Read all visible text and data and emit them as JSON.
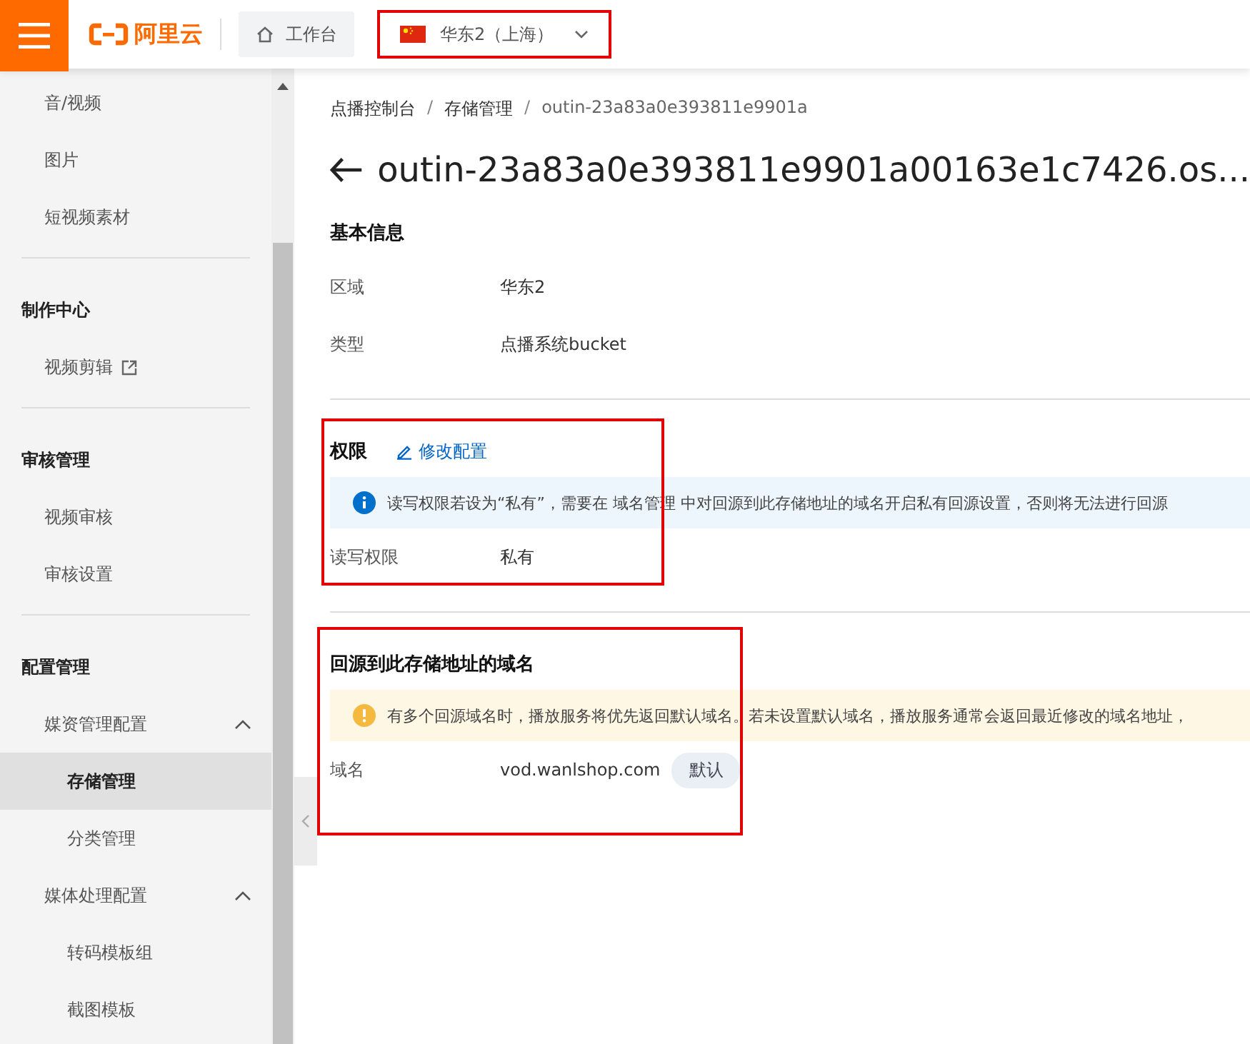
{
  "header": {
    "logo": "阿里云",
    "workbench": "工作台",
    "region": {
      "label": "华东2（上海）",
      "highlighted": true
    }
  },
  "sidebar": {
    "groups": [
      {
        "items": [
          {
            "label": "音/视频",
            "selected": false
          },
          {
            "label": "图片",
            "selected": false
          },
          {
            "label": "短视频素材",
            "selected": false
          }
        ]
      },
      {
        "title": "制作中心",
        "items": [
          {
            "label": "视频剪辑",
            "selected": false,
            "external": true
          }
        ]
      },
      {
        "title": "审核管理",
        "items": [
          {
            "label": "视频审核",
            "selected": false
          },
          {
            "label": "审核设置",
            "selected": false
          }
        ]
      },
      {
        "title": "配置管理",
        "items": [
          {
            "label": "媒资管理配置",
            "expanded": true,
            "children": [
              {
                "label": "存储管理",
                "selected": true
              },
              {
                "label": "分类管理",
                "selected": false
              }
            ]
          },
          {
            "label": "媒体处理配置",
            "expanded": true,
            "children": [
              {
                "label": "转码模板组",
                "selected": false
              },
              {
                "label": "截图模板",
                "selected": false
              }
            ]
          }
        ]
      }
    ]
  },
  "breadcrumb": [
    "点播控制台",
    "存储管理",
    "outin-23a83a0e393811e9901a"
  ],
  "breadcrumb_separator": "/",
  "title": "outin-23a83a0e393811e9901a00163e1c7426.os...",
  "sections": [
    {
      "title": "基本信息",
      "highlighted": false,
      "fields": [
        {
          "label": "区域",
          "value": "华东2"
        },
        {
          "label": "类型",
          "value": "点播系统bucket"
        }
      ]
    },
    {
      "title": "权限",
      "highlighted": true,
      "action": "修改配置",
      "notice": {
        "kind": "info",
        "text": "读写权限若设为“私有”，需要在 域名管理 中对回源到此存储地址的域名开启私有回源设置，否则将无法进行回源"
      },
      "fields": [
        {
          "label": "读写权限",
          "value": "私有"
        }
      ]
    },
    {
      "title": "回源到此存储地址的域名",
      "highlighted": true,
      "notice": {
        "kind": "warning",
        "text": "有多个回源域名时，播放服务将优先返回默认域名。若未设置默认域名，播放服务通常会返回最近修改的域名地址，"
      },
      "fields": [
        {
          "label": "域名",
          "value": "vod.wanlshop.com",
          "tag": "默认"
        }
      ]
    }
  ]
}
